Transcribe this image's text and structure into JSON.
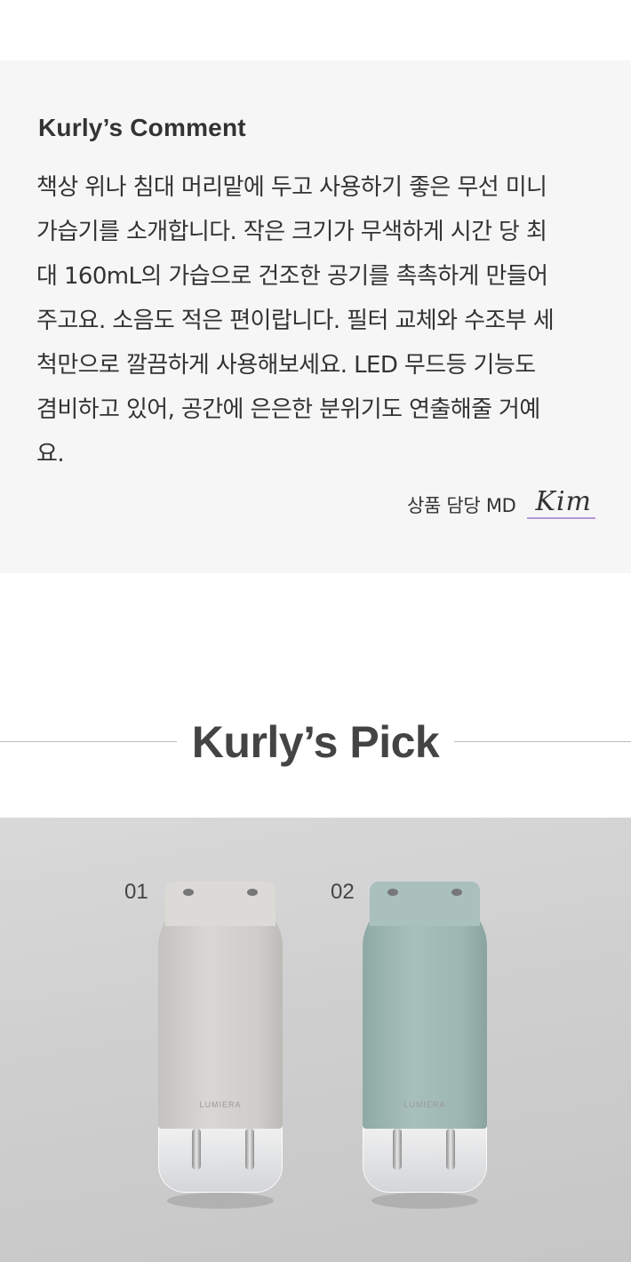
{
  "comment": {
    "title": "Kurly’s Comment",
    "lines": [
      "책상 위나 침대 머리맡에 두고 사용하기 좋은 무선 미니",
      "가습기를 소개합니다. 작은 크기가 무색하게 시간 당 최",
      "대 160mL의 가습으로 건조한 공기를 촉촉하게 만들어",
      "주고요. 소음도 적은 편이랍니다. 필터 교체와 수조부 세",
      "척만으로 깔끔하게 사용해보세요. LED 무드등 기능도",
      "겸비하고 있어, 공간에 은은한 분위기도 연출해줄 거예",
      "요."
    ],
    "md_label": "상품 담당 MD",
    "md_name": "Kim"
  },
  "pick": {
    "title": "Kurly’s Pick",
    "items": [
      {
        "number": "01",
        "color": "#d3d1cd",
        "brand": "LUMIERA"
      },
      {
        "number": "02",
        "color": "#9fb8b3",
        "brand": "LUMIERA"
      }
    ]
  }
}
